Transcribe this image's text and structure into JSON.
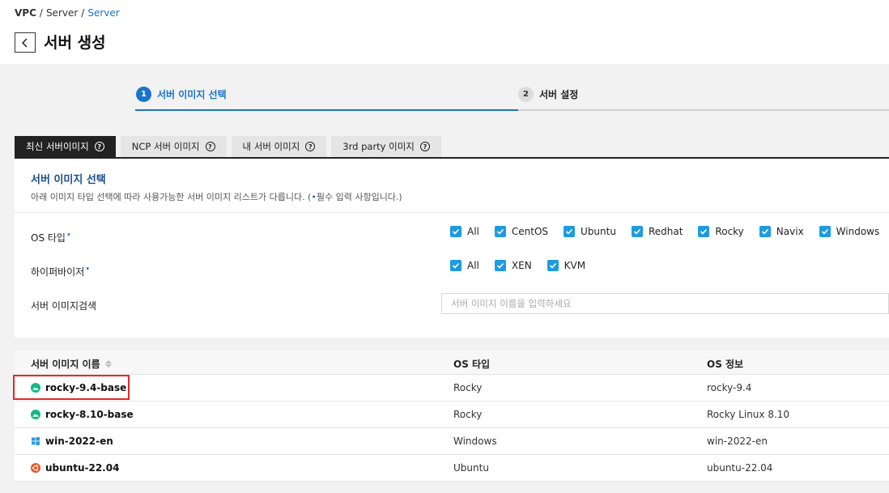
{
  "breadcrumb": {
    "root": "VPC",
    "sep1": "/",
    "mid": "Server",
    "sep2": "/",
    "current": "Server"
  },
  "page": {
    "title": "서버 생성"
  },
  "steps": [
    {
      "num": "1",
      "label": "서버 이미지 선택",
      "active": true
    },
    {
      "num": "2",
      "label": "서버 설정",
      "active": false
    }
  ],
  "tabs": [
    {
      "label": "최신 서버이미지",
      "active": true
    },
    {
      "label": "NCP 서버 이미지",
      "active": false
    },
    {
      "label": "내 서버 이미지",
      "active": false
    },
    {
      "label": "3rd party 이미지",
      "active": false
    }
  ],
  "panel": {
    "title": "서버 이미지 선택",
    "desc_prefix": "아래 이미지 타입 선택에 따라 사용가능한 서버 이미지 리스트가 다릅니다. (",
    "desc_dot": "•",
    "desc_suffix": "필수 입력 사항입니다.)",
    "os_label": "OS 타입",
    "hv_label": "하이퍼바이저",
    "search_label": "서버 이미지검색",
    "required_mark": "•",
    "os_options": [
      {
        "label": "All",
        "checked": true
      },
      {
        "label": "CentOS",
        "checked": true
      },
      {
        "label": "Ubuntu",
        "checked": true
      },
      {
        "label": "Redhat",
        "checked": true
      },
      {
        "label": "Rocky",
        "checked": true
      },
      {
        "label": "Navix",
        "checked": true
      },
      {
        "label": "Windows",
        "checked": true
      }
    ],
    "hv_options": [
      {
        "label": "All",
        "checked": true
      },
      {
        "label": "XEN",
        "checked": true
      },
      {
        "label": "KVM",
        "checked": true
      }
    ],
    "search_placeholder": "서버 이미지 이름을 입력하세요"
  },
  "table": {
    "headers": {
      "name": "서버 이미지 이름",
      "os_type": "OS 타입",
      "os_info": "OS 정보"
    },
    "rows": [
      {
        "name": "rocky-9.4-base",
        "os_type": "Rocky",
        "os_info": "rocky-9.4",
        "icon": "rocky-icon",
        "highlighted": true
      },
      {
        "name": "rocky-8.10-base",
        "os_type": "Rocky",
        "os_info": "Rocky Linux 8.10",
        "icon": "rocky-icon",
        "highlighted": false
      },
      {
        "name": "win-2022-en",
        "os_type": "Windows",
        "os_info": "win-2022-en",
        "icon": "windows-icon",
        "highlighted": false
      },
      {
        "name": "ubuntu-22.04",
        "os_type": "Ubuntu",
        "os_info": "ubuntu-22.04",
        "icon": "ubuntu-icon",
        "highlighted": false
      }
    ]
  },
  "colors": {
    "accent": "#1a73c8",
    "checkbox": "#1e9be0",
    "highlight": "#e12b2b",
    "rocky": "#10b981",
    "windows": "#2b9be0",
    "ubuntu": "#e95420"
  }
}
